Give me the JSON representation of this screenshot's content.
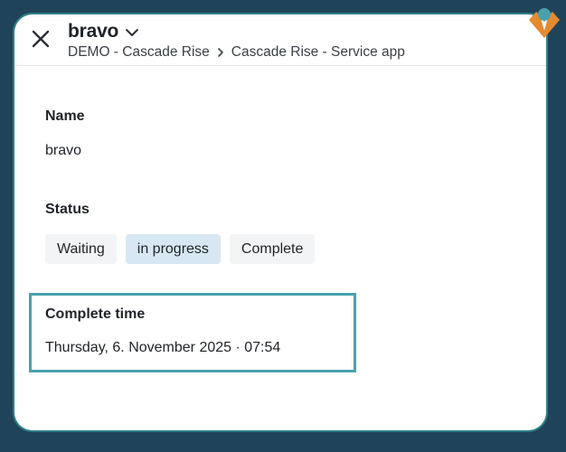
{
  "header": {
    "title": "bravo",
    "breadcrumb": [
      "DEMO - Cascade Rise",
      "Cascade Rise - Service app"
    ]
  },
  "fields": {
    "name": {
      "label": "Name",
      "value": "bravo"
    },
    "status": {
      "label": "Status",
      "options": [
        "Waiting",
        "in progress",
        "Complete"
      ],
      "selected": "in progress"
    },
    "complete_time": {
      "label": "Complete time",
      "value": "Thursday, 6. November 2025 · 07:54"
    }
  },
  "colors": {
    "background": "#1f4459",
    "card": "#ffffff",
    "selected_status": "#d7e7f3",
    "highlight_border": "#4aa1ad",
    "logo_orange": "#e58a2f",
    "logo_teal": "#4aa1ad"
  },
  "icons": {
    "close": "close-icon",
    "title_dropdown": "chevron-down-icon",
    "breadcrumb_separator": "chevron-right-icon",
    "brand": "logo-icon"
  }
}
